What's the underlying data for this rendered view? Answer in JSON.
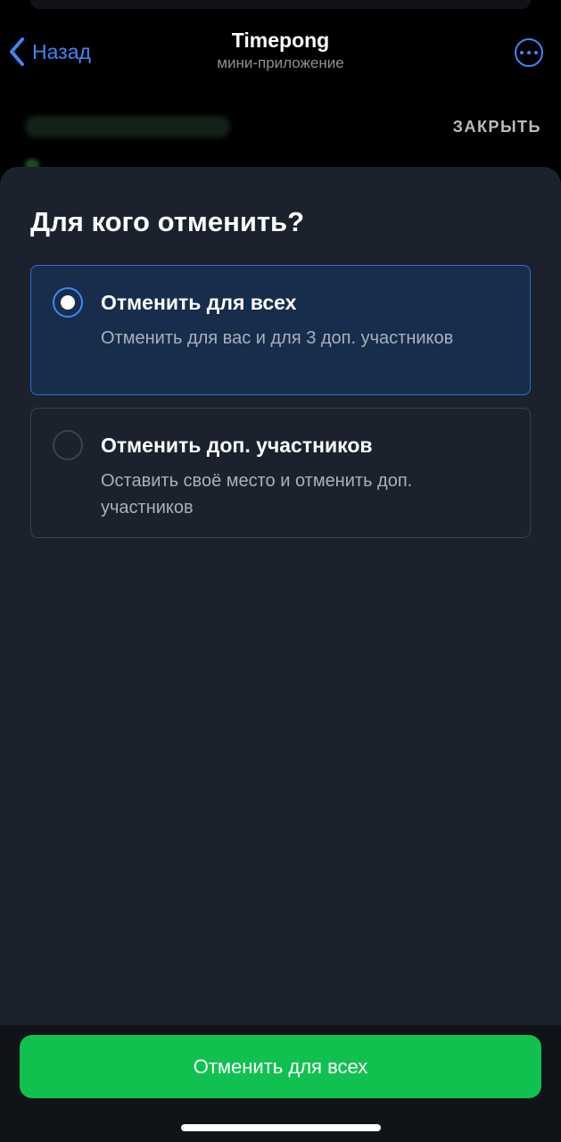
{
  "nav": {
    "back_label": "Назад",
    "title": "Timepong",
    "subtitle": "мини-приложение",
    "more_icon": "ellipsis-circle-icon",
    "back_icon": "chevron-left-icon"
  },
  "behind": {
    "close_label": "ЗАКРЫТЬ"
  },
  "sheet": {
    "title": "Для кого отменить?",
    "options": [
      {
        "title": "Отменить для всех",
        "description": "Отменить для вас и для 3 доп. участников",
        "selected": true
      },
      {
        "title": "Отменить доп. участников",
        "description": "Оставить своё место и отменить доп. участников",
        "selected": false
      }
    ]
  },
  "footer": {
    "primary_button_label": "Отменить для всех"
  },
  "colors": {
    "accent_blue": "#3f87f5",
    "confirm_green": "#11c150",
    "sheet_bg": "#1b222d",
    "selected_option_bg": "#182d4c"
  }
}
